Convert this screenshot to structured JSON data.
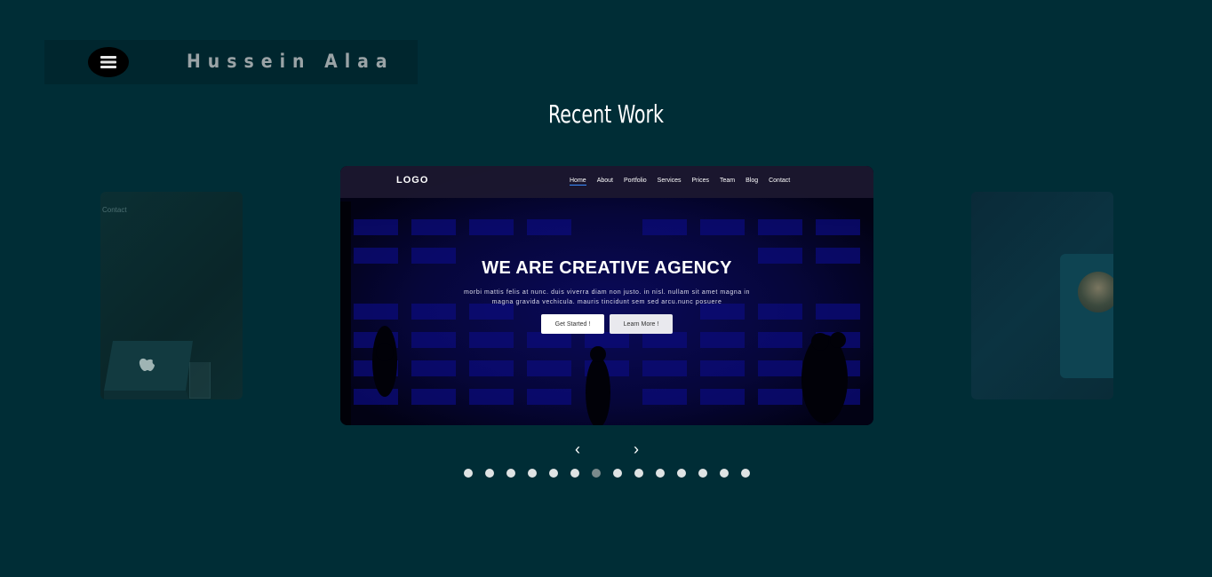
{
  "header": {
    "brand": "Hussein Alaa",
    "menu_icon": "hamburger-menu-icon"
  },
  "section": {
    "title": "Recent Work"
  },
  "slides": {
    "left": {
      "nav_text": "Contact"
    },
    "center": {
      "logo": "LOGO",
      "nav": [
        "Home",
        "About",
        "Portfolio",
        "Services",
        "Prices",
        "Team",
        "Blog",
        "Contact"
      ],
      "headline": "WE ARE CREATIVE AGENCY",
      "body_line1": "morbi mattis felis at nunc. duis viverra diam non justo. in nisl. nullam sit amet magna in",
      "body_line2": "magna gravida vechicula. mauris tincidunt sem sed arcu.nunc posuere",
      "btn_primary": "Get Started !",
      "btn_secondary": "Learn More !"
    }
  },
  "controls": {
    "prev": "‹",
    "next": "›",
    "dot_count": 14,
    "active_dot": 7
  },
  "colors": {
    "background": "#002d36",
    "header_bg": "#00262e",
    "brand_text": "#9aa3a6",
    "dot": "#dfe3e4",
    "dot_active": "#7b8a8c"
  }
}
